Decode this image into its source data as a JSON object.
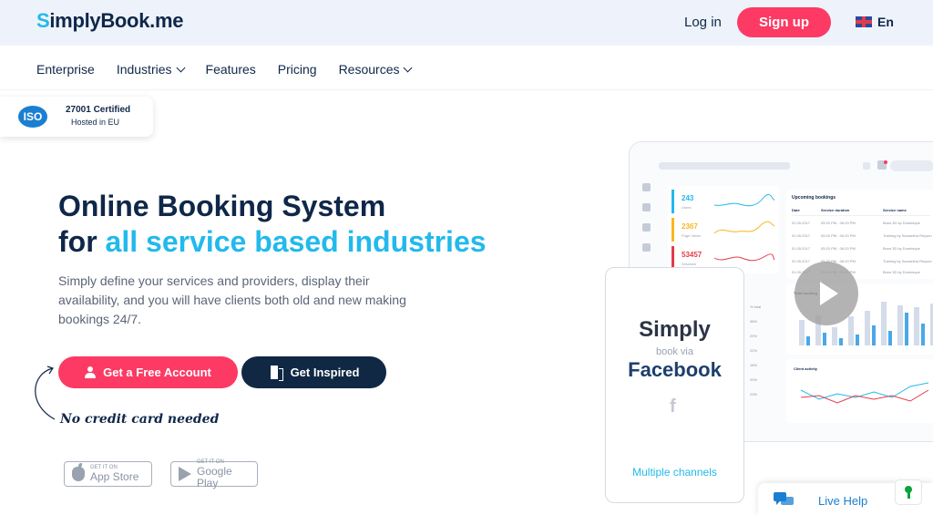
{
  "header": {
    "logo": {
      "prefix": "S",
      "rest": "implyBook.me"
    },
    "login_label": "Log in",
    "signup_label": "Sign up",
    "language": "En"
  },
  "nav": {
    "items": [
      {
        "label": "Enterprise",
        "has_dropdown": false
      },
      {
        "label": "Industries",
        "has_dropdown": true
      },
      {
        "label": "Features",
        "has_dropdown": false
      },
      {
        "label": "Pricing",
        "has_dropdown": false
      },
      {
        "label": "Resources",
        "has_dropdown": true
      }
    ]
  },
  "certificate": {
    "logo_text": "ISO",
    "line1": "27001 Certified",
    "line2": "Hosted in EU"
  },
  "hero": {
    "title_line1": "Online Booking System",
    "title_line2_prefix": "for",
    "title_line2_accent": "all service based industries",
    "description": "Simply define your services and providers, display their availability, and you will have clients both old and new making bookings 24/7.",
    "primary_button": "Get a Free Account",
    "secondary_button": "Get Inspired",
    "note": "No credit card needed"
  },
  "stores": {
    "apple": {
      "small": "GET IT ON",
      "big": "App Store"
    },
    "google": {
      "small": "GET IT ON",
      "big": "Google Play"
    }
  },
  "dashboard": {
    "stats": [
      {
        "value": "243",
        "label": "Users",
        "color": "#22b9ec"
      },
      {
        "value": "2367",
        "label": "Page Views",
        "color": "#f5b921"
      },
      {
        "value": "53457",
        "label": "Sessions",
        "color": "#e23b4b"
      }
    ],
    "bookings_title": "Upcoming bookings",
    "bookings_headers": [
      "Date",
      "Service duration",
      "Service name"
    ],
    "bookings_rows": [
      [
        "01.05.2017",
        "05:20 PM - 06:20 PM",
        "Brow 3D by Dominique"
      ],
      [
        "01.05.2017",
        "05:20 PM - 06:20 PM",
        "Training by Samantha Reyson"
      ],
      [
        "01.05.2017",
        "05:20 PM - 06:20 PM",
        "Brow 3D by Dominique"
      ],
      [
        "01.05.2017",
        "05:20 PM - 06:20 PM",
        "Training by Samantha Reyson"
      ],
      [
        "01.05.2017",
        "05:20 PM - 06:20 PM",
        "Brow 3D by Dominique"
      ]
    ],
    "pct_header": "% total",
    "pct_values": [
      "38%",
      "29%",
      "22%",
      "18%",
      "20%",
      "23%"
    ],
    "total_title": "Total booking",
    "client_title": "Client activity"
  },
  "phone": {
    "title": "Simply",
    "via": "book via",
    "channel": "Facebook",
    "channel_icon": "f",
    "footer": "Multiple channels"
  },
  "livehelp": {
    "label": "Live Help"
  }
}
